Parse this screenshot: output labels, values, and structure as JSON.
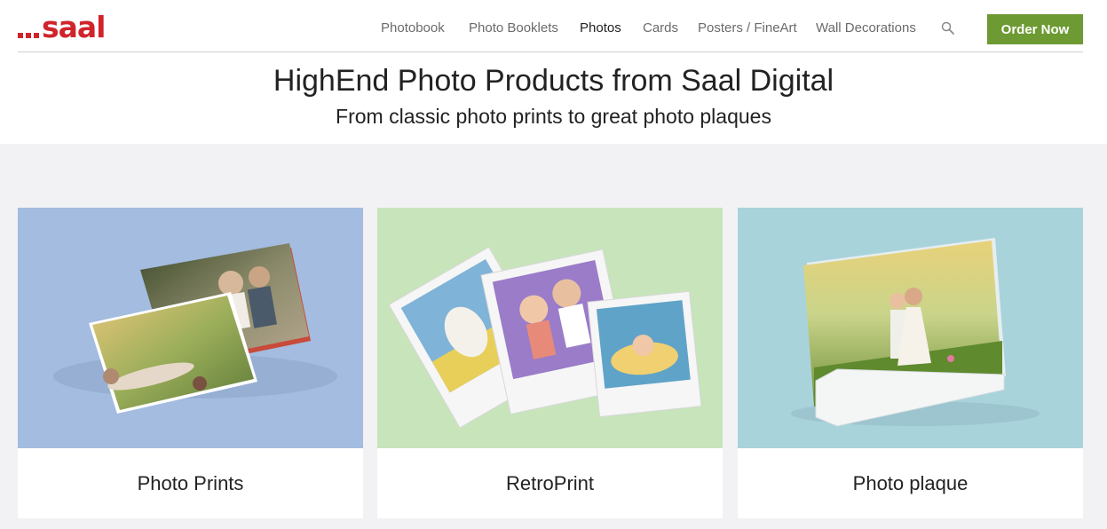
{
  "header": {
    "logo_text": "saal",
    "nav": [
      {
        "label": "Photobook"
      },
      {
        "label": "Photo Booklets"
      },
      {
        "label": "Photos",
        "active": true
      },
      {
        "label": "Cards"
      },
      {
        "label": "Posters / FineArt"
      },
      {
        "label": "Wall Decorations"
      }
    ],
    "order_button": "Order Now"
  },
  "hero": {
    "title": "HighEnd Photo Products from Saal Digital",
    "subtitle": "From classic photo prints to great photo plaques"
  },
  "products": [
    {
      "label": "Photo Prints",
      "bg": "#a3bcdf"
    },
    {
      "label": "RetroPrint",
      "bg": "#c7e4bb"
    },
    {
      "label": "Photo plaque",
      "bg": "#a9d3db"
    }
  ],
  "colors": {
    "brand_red": "#d0242b",
    "accent_green": "#6d9a32",
    "section_bg": "#f2f2f4"
  },
  "icons": {
    "search": "search-icon"
  }
}
